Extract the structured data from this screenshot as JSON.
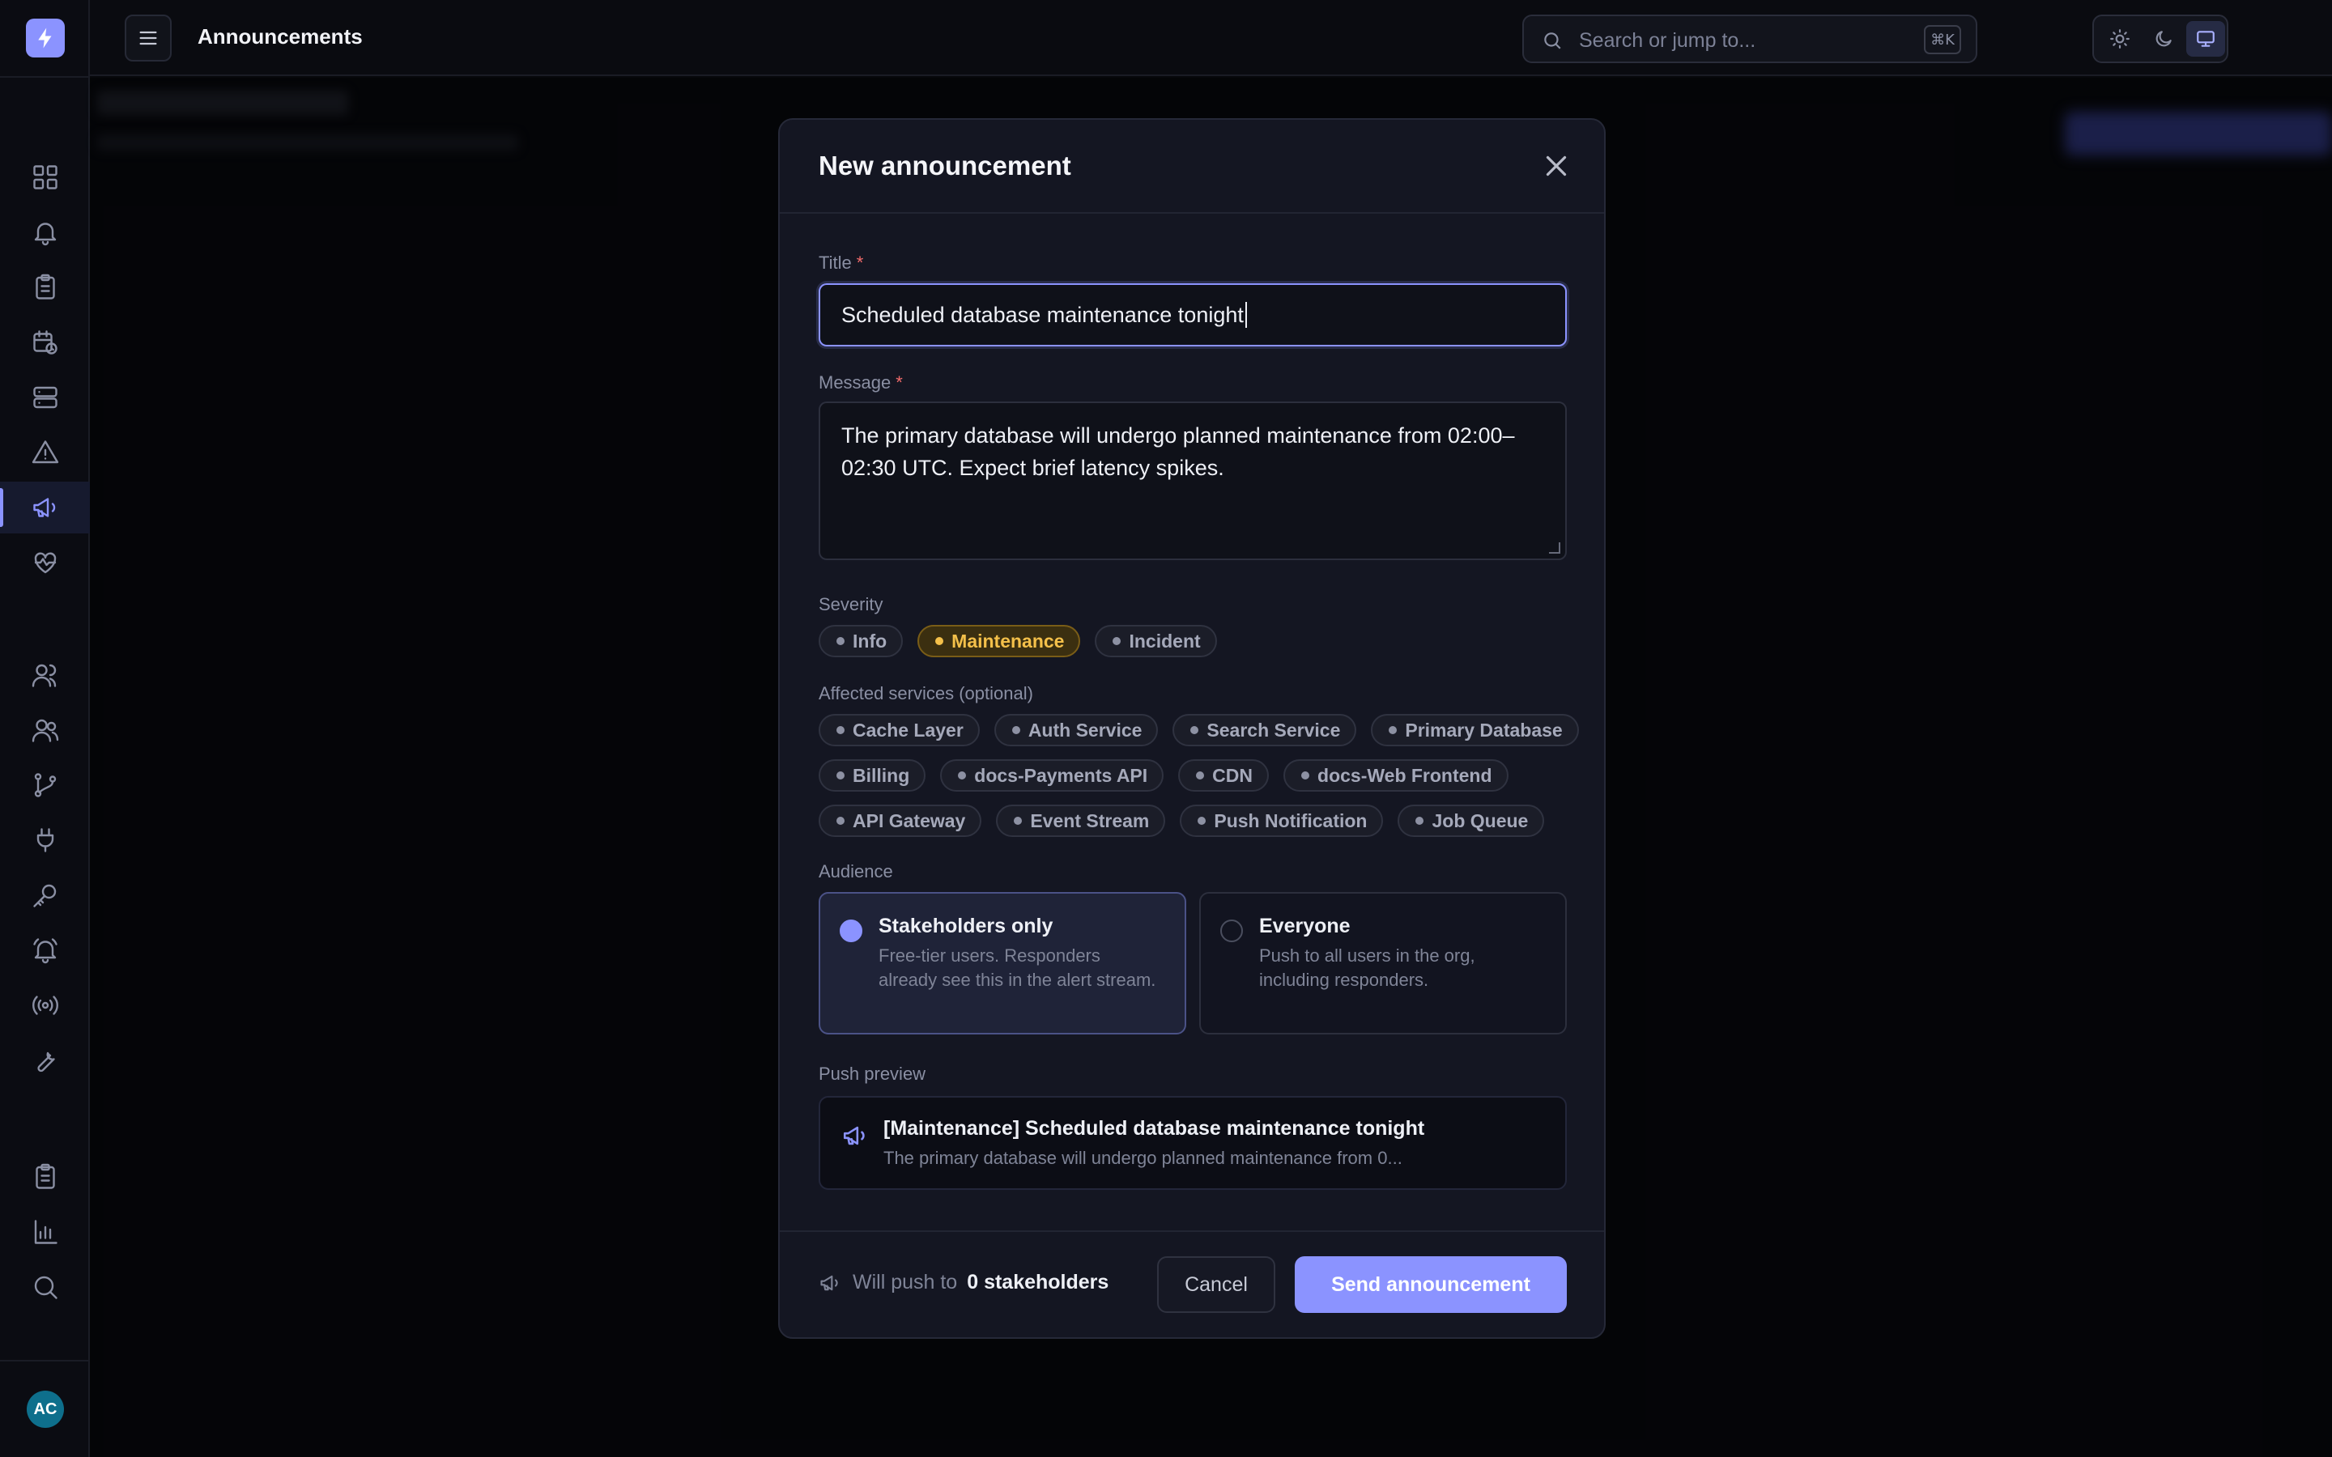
{
  "app": {
    "page_title": "Announcements"
  },
  "search": {
    "placeholder": "Search or jump to...",
    "shortcut": "⌘K"
  },
  "user": {
    "initials": "AC"
  },
  "sidebar": {
    "items": [
      {
        "icon": "dashboard-icon"
      },
      {
        "icon": "bell-icon"
      },
      {
        "icon": "clipboard-icon"
      },
      {
        "icon": "calendar-clock-icon"
      },
      {
        "icon": "server-icon"
      },
      {
        "icon": "warning-icon"
      },
      {
        "icon": "megaphone-icon",
        "active": true
      },
      {
        "icon": "heart-pulse-icon"
      },
      {
        "icon": "user-icon"
      },
      {
        "icon": "users-icon"
      },
      {
        "icon": "git-branch-icon"
      },
      {
        "icon": "plug-icon"
      },
      {
        "icon": "key-icon"
      },
      {
        "icon": "bell-ring-icon"
      },
      {
        "icon": "broadcast-icon"
      },
      {
        "icon": "wrench-icon"
      },
      {
        "icon": "clipboard-list-icon"
      },
      {
        "icon": "bar-chart-icon"
      },
      {
        "icon": "search-icon"
      }
    ]
  },
  "modal": {
    "title": "New announcement",
    "title_label": "Title",
    "title_value": "Scheduled database maintenance tonight",
    "message_label": "Message",
    "message_value": "The primary database will undergo planned maintenance from 02:00–02:30 UTC. Expect brief latency spikes.",
    "required_mark": "*",
    "severity_label": "Severity",
    "severity_options": [
      "Info",
      "Maintenance",
      "Incident"
    ],
    "severity_selected": "Maintenance",
    "services_label": "Affected services (optional)",
    "services_rows": [
      [
        "Cache Layer",
        "Auth Service",
        "Search Service",
        "Primary Database"
      ],
      [
        "Billing",
        "docs-Payments API",
        "CDN",
        "docs-Web Frontend"
      ],
      [
        "API Gateway",
        "Event Stream",
        "Push Notification",
        "Job Queue"
      ]
    ],
    "audience_label": "Audience",
    "audience": [
      {
        "title": "Stakeholders only",
        "desc": "Free-tier users. Responders already see this in the alert stream.",
        "selected": true
      },
      {
        "title": "Everyone",
        "desc": "Push to all users in the org, including responders.",
        "selected": false
      }
    ],
    "preview_label": "Push preview",
    "preview_title": "[Maintenance] Scheduled database maintenance tonight",
    "preview_body": "The primary database will undergo planned maintenance from 0...",
    "footer_prefix": "Will push to",
    "footer_count": "0 stakeholders",
    "cancel_label": "Cancel",
    "send_label": "Send announcement"
  },
  "colors": {
    "accent": "#8b93ff",
    "maintenance": "#f4c04a",
    "required": "#f26b6b"
  }
}
